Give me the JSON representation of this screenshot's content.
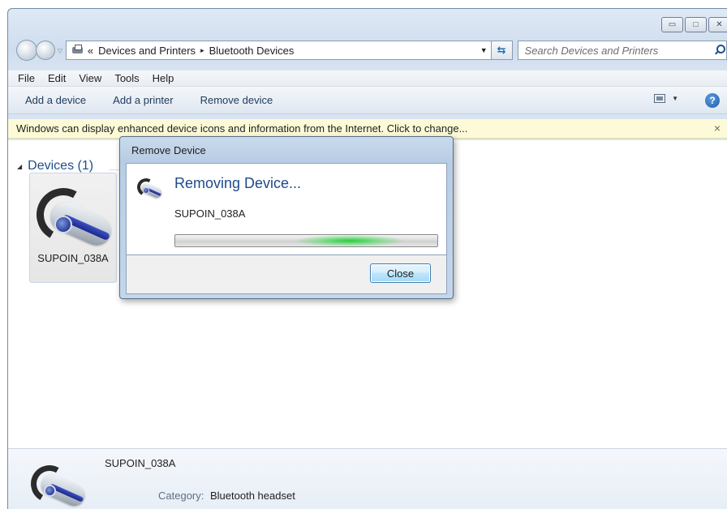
{
  "window": {
    "caption_buttons": {
      "minimize_icon": "minimize-icon",
      "maximize_icon": "maximize-icon",
      "close_icon": "close-icon"
    }
  },
  "address_bar": {
    "back_icon": "back-arrow-icon",
    "forward_icon": "forward-arrow-icon",
    "overflow": "«",
    "path": [
      "Devices and Printers",
      "Bluetooth Devices"
    ],
    "separator": "▸",
    "search_placeholder": "Search Devices and Printers"
  },
  "menu": {
    "items": [
      "File",
      "Edit",
      "View",
      "Tools",
      "Help"
    ]
  },
  "command_bar": {
    "add_device": "Add a device",
    "add_printer": "Add a printer",
    "remove_device": "Remove device",
    "help_symbol": "?"
  },
  "info_bar": {
    "message": "Windows can display enhanced device icons and information from the Internet. Click to change...",
    "close_symbol": "×"
  },
  "devices_group": {
    "header": "Devices (1)",
    "devices": [
      {
        "name": "SUPOIN_038A",
        "icon": "bluetooth-headset-icon"
      }
    ]
  },
  "dialog": {
    "title": "Remove Device",
    "heading": "Removing Device...",
    "device_name": "SUPOIN_038A",
    "progress_state": "indeterminate",
    "close_label": "Close"
  },
  "details_pane": {
    "name": "SUPOIN_038A",
    "category_label": "Category:",
    "category_value": "Bluetooth headset"
  },
  "colors": {
    "info_bar_bg": "#fdfbd7",
    "accent_blue": "#1e4a8a",
    "progress_green": "#21cc38"
  }
}
